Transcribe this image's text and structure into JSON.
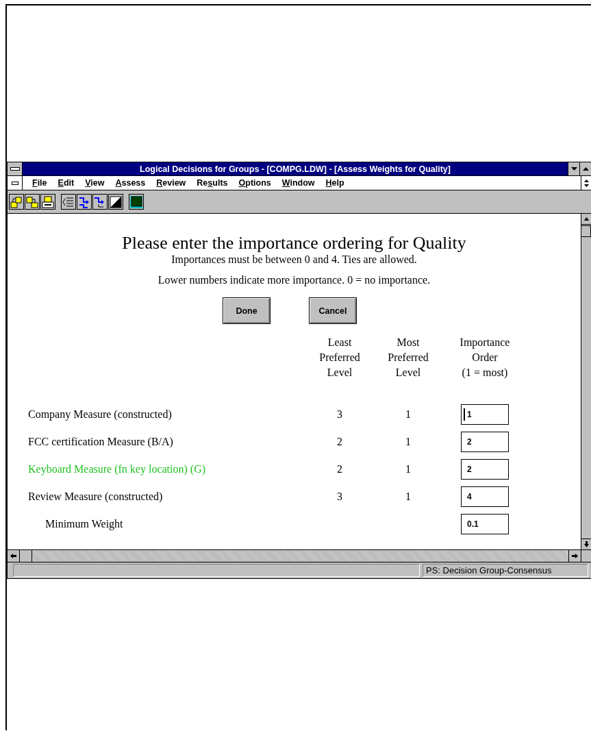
{
  "window": {
    "title": "Logical Decisions for Groups - [COMPG.LDW] - [Assess Weights for Quality]"
  },
  "menu": [
    {
      "accelerator": "F",
      "after": "ile"
    },
    {
      "accelerator": "E",
      "after": "dit"
    },
    {
      "accelerator": "V",
      "after": "iew"
    },
    {
      "accelerator": "A",
      "after": "ssess"
    },
    {
      "accelerator": "R",
      "after": "eview"
    },
    {
      "before": "Re",
      "accelerator": "s",
      "after": "ults"
    },
    {
      "accelerator": "O",
      "after": "ptions"
    },
    {
      "accelerator": "W",
      "after": "indow"
    },
    {
      "accelerator": "H",
      "after": "elp"
    }
  ],
  "toolbar": [
    {
      "kind": "open"
    },
    {
      "kind": "save"
    },
    {
      "kind": "print"
    },
    {
      "kind": "list"
    },
    {
      "kind": "arrows"
    },
    {
      "kind": "arrows2"
    },
    {
      "kind": "contrast"
    },
    {
      "kind": "green"
    }
  ],
  "dialog": {
    "heading": "Please enter the importance ordering for Quality",
    "notes": [
      "Importances must be between 0 and 4.  Ties are allowed.",
      "Lower numbers indicate more importance. 0 = no importance."
    ],
    "buttons": [
      "Done",
      "Cancel"
    ],
    "columns": [
      {
        "lines": [
          "Least",
          "Preferred",
          "Level"
        ]
      },
      {
        "lines": [
          "Most",
          "Preferred",
          "Level"
        ]
      },
      {
        "lines": [
          "Importance",
          "Order",
          "(1 = most)"
        ]
      }
    ],
    "rows": [
      {
        "kind": "measure",
        "name": "Company Measure (constructed)",
        "least": "3",
        "most": "1",
        "order": "1",
        "focused": true,
        "color": "#000000"
      },
      {
        "kind": "measure",
        "name": "FCC certification Measure (B/A)",
        "least": "2",
        "most": "1",
        "order": "2",
        "focused": false,
        "color": "#000000"
      },
      {
        "kind": "measure",
        "name": "Keyboard Measure (fn key location) (G)",
        "least": "2",
        "most": "1",
        "order": "2",
        "focused": false,
        "color": "#22c022"
      },
      {
        "kind": "measure",
        "name": "Review Measure (constructed)",
        "least": "3",
        "most": "1",
        "order": "4",
        "focused": false,
        "color": "#000000"
      },
      {
        "kind": "weight",
        "name": "Minimum Weight",
        "order": "0.1",
        "focused": false,
        "color": "#000000"
      }
    ]
  },
  "status_bar": {
    "text": "PS: Decision Group-Consensus"
  }
}
